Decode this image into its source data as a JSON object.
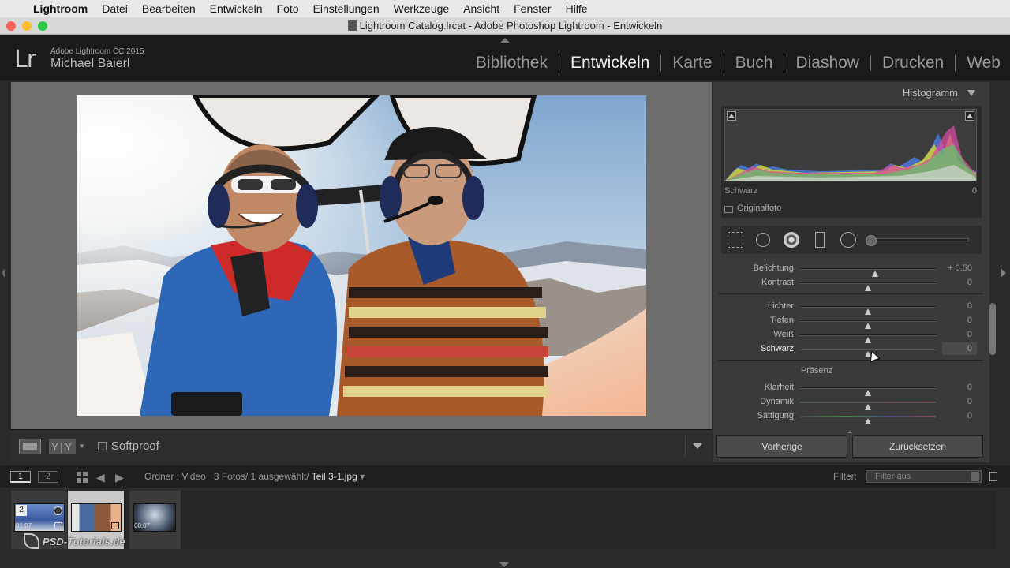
{
  "menubar": {
    "app": "Lightroom",
    "items": [
      "Datei",
      "Bearbeiten",
      "Entwickeln",
      "Foto",
      "Einstellungen",
      "Werkzeuge",
      "Ansicht",
      "Fenster",
      "Hilfe"
    ]
  },
  "titlebar": {
    "title": "Lightroom Catalog.lrcat - Adobe Photoshop Lightroom - Entwickeln"
  },
  "identity": {
    "logo": "Lr",
    "product": "Adobe Lightroom CC 2015",
    "user": "Michael Baierl"
  },
  "modules": [
    "Bibliothek",
    "Entwickeln",
    "Karte",
    "Buch",
    "Diashow",
    "Drucken",
    "Web"
  ],
  "active_module": "Entwickeln",
  "toolbar": {
    "yy": "Y|Y",
    "softproof": "Softproof"
  },
  "histogram": {
    "title": "Histogramm",
    "readout_label": "Schwarz",
    "readout_value": "0",
    "original_label": "Originalfoto"
  },
  "basic": {
    "sliders": [
      {
        "label": "Belichtung",
        "value": "+ 0,50",
        "pos": 0.55
      },
      {
        "label": "Kontrast",
        "value": "0",
        "pos": 0.5
      },
      {
        "label": "Lichter",
        "value": "0",
        "pos": 0.5
      },
      {
        "label": "Tiefen",
        "value": "0",
        "pos": 0.5
      },
      {
        "label": "Weiß",
        "value": "0",
        "pos": 0.5
      },
      {
        "label": "Schwarz",
        "value": "0",
        "pos": 0.5
      },
      {
        "label": "Klarheit",
        "value": "0",
        "pos": 0.5
      },
      {
        "label": "Dynamik",
        "value": "0",
        "pos": 0.5
      },
      {
        "label": "Sättigung",
        "value": "0",
        "pos": 0.5
      }
    ],
    "presence_label": "Präsenz"
  },
  "buttons": {
    "previous": "Vorherige",
    "reset": "Zurücksetzen"
  },
  "filmbar": {
    "monitor1": "1",
    "monitor2": "2",
    "source": "Ordner : Video",
    "count": "3 Fotos/ 1 ausgewählt/",
    "file": "Teil 3-1.jpg",
    "filter_label": "Filter:",
    "filter_value": "Filter aus"
  },
  "filmstrip": [
    {
      "stack": "2",
      "duration": "01:07"
    },
    {
      "stack": "",
      "duration": ""
    },
    {
      "stack": "",
      "duration": "00:07"
    }
  ],
  "watermark": "PSD-Tutorials.de",
  "colors": {
    "accent": "#eeeeee",
    "panel": "#3a3a3a",
    "background": "#2b2b2b"
  }
}
